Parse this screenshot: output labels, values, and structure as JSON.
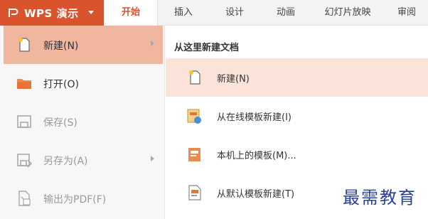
{
  "app": {
    "title": "WPS 演示"
  },
  "ribbon": {
    "tabs": [
      {
        "label": "开始"
      },
      {
        "label": "插入"
      },
      {
        "label": "设计"
      },
      {
        "label": "动画"
      },
      {
        "label": "幻灯片放映"
      },
      {
        "label": "审阅"
      }
    ]
  },
  "file_menu": {
    "items": [
      {
        "label": "新建(N)",
        "icon": "new-document-icon"
      },
      {
        "label": "打开(O)",
        "icon": "folder-icon"
      },
      {
        "label": "保存(S)",
        "icon": "save-icon"
      },
      {
        "label": "另存为(A)",
        "icon": "save-as-icon"
      },
      {
        "label": "输出为PDF(F)",
        "icon": "pdf-export-icon"
      }
    ]
  },
  "new_panel": {
    "title": "从这里新建文档",
    "items": [
      {
        "label": "新建(N)",
        "icon": "new-blank-icon"
      },
      {
        "label": "从在线模板新建(I)",
        "icon": "online-template-icon"
      },
      {
        "label": "本机上的模板(M)...",
        "icon": "local-template-icon"
      },
      {
        "label": "从默认模板新建(T)",
        "icon": "default-template-icon"
      }
    ]
  },
  "watermark": {
    "text": "最需教育"
  },
  "colors": {
    "accent": "#d9532c",
    "highlight": "#f0b69f",
    "highlight_light": "#fbe3da"
  }
}
